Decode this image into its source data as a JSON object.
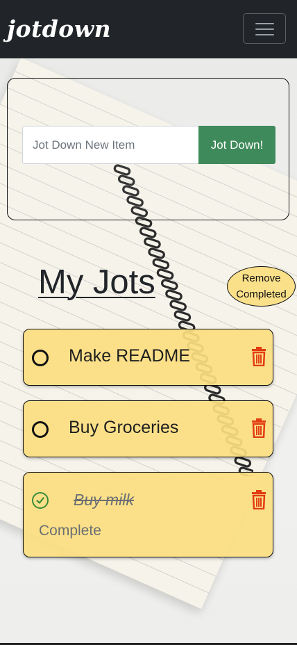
{
  "navbar": {
    "brand": "jotdown",
    "toggle_icon": "hamburger-menu-icon"
  },
  "form": {
    "placeholder": "Jot Down New Item",
    "value": "",
    "submit_label": "Jot Down!",
    "submit_color": "#3f8a5a"
  },
  "list": {
    "title": "My Jots",
    "remove_label": "Remove Completed",
    "card_color": "#fbde80",
    "items": [
      {
        "text": "Make README",
        "completed": false,
        "check_icon": "circle-icon",
        "delete_icon": "trash-icon"
      },
      {
        "text": "Buy Groceries",
        "completed": false,
        "check_icon": "circle-icon",
        "delete_icon": "trash-icon"
      },
      {
        "text": "Buy milk",
        "completed": true,
        "check_icon": "check-circle-icon",
        "delete_icon": "trash-icon",
        "status": "Complete"
      }
    ]
  },
  "colors": {
    "navbar": "#212529",
    "trash": "#e23c12",
    "complete_check": "#3a8a3a"
  }
}
